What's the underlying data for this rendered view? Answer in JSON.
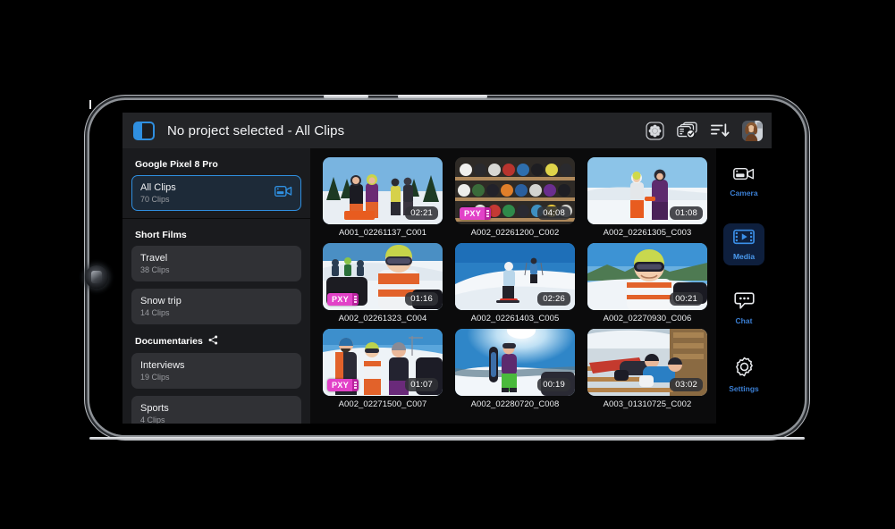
{
  "header": {
    "title": "No project selected - All Clips",
    "panel_toggle_icon": "sidebar-panel-icon",
    "actions": [
      {
        "name": "effects-button",
        "icon": "flower-burst-icon"
      },
      {
        "name": "select-clips-button",
        "icon": "stacked-cards-check-icon"
      },
      {
        "name": "sort-button",
        "icon": "sort-descending-icon"
      },
      {
        "name": "account-avatar",
        "icon": "user-avatar-icon"
      }
    ]
  },
  "library": {
    "device_heading": "Google Pixel 8 Pro",
    "all_clips": {
      "name": "All Clips",
      "count": "70 Clips",
      "icon": "video-camera-icon"
    },
    "groups": [
      {
        "heading": "Short Films",
        "shared": false,
        "items": [
          {
            "name": "Travel",
            "count": "38 Clips"
          },
          {
            "name": "Snow trip",
            "count": "14 Clips"
          }
        ]
      },
      {
        "heading": "Documentaries",
        "shared": true,
        "share_icon": "share-nodes-icon",
        "items": [
          {
            "name": "Interviews",
            "count": "19 Clips"
          },
          {
            "name": "Sports",
            "count": "4 Clips"
          }
        ]
      }
    ]
  },
  "clips": [
    {
      "filename": "A001_02261137_C001",
      "duration": "02:21",
      "proxy": false,
      "scene": "group-skiers-trees"
    },
    {
      "filename": "A002_02261200_C002",
      "duration": "04:08",
      "proxy": true,
      "scene": "helmet-shelf-rental"
    },
    {
      "filename": "A002_02261305_C003",
      "duration": "01:08",
      "proxy": false,
      "scene": "couple-snow-slope"
    },
    {
      "filename": "A002_02261323_C004",
      "duration": "01:16",
      "proxy": true,
      "scene": "skier-green-helmet-portrait"
    },
    {
      "filename": "A002_02261403_C005",
      "duration": "02:26",
      "proxy": false,
      "scene": "snowboarder-blue-sky"
    },
    {
      "filename": "A002_02270930_C006",
      "duration": "00:21",
      "proxy": false,
      "scene": "smiling-skier-mountains"
    },
    {
      "filename": "A002_02271500_C007",
      "duration": "01:07",
      "proxy": true,
      "scene": "three-friends-slope"
    },
    {
      "filename": "A002_02280720_C008",
      "duration": "00:19",
      "proxy": false,
      "scene": "snowboarder-sun-summit"
    },
    {
      "filename": "A003_01310725_C002",
      "duration": "03:02",
      "proxy": false,
      "scene": "lounging-deck-chairs"
    }
  ],
  "proxy_badge_label": "PXY",
  "rail": [
    {
      "label": "Camera",
      "icon": "video-camera-icon",
      "active": false
    },
    {
      "label": "Media",
      "icon": "film-play-icon",
      "active": true
    },
    {
      "label": "Chat",
      "icon": "chat-bubble-icon",
      "active": false
    },
    {
      "label": "Settings",
      "icon": "gear-icon",
      "active": false
    }
  ],
  "colors": {
    "accent_blue": "#2f8fe0",
    "rail_blue": "#3b7fd4",
    "proxy_magenta": "#e242c8",
    "panel_bg": "#1a1b1e",
    "header_bg": "#232427"
  }
}
